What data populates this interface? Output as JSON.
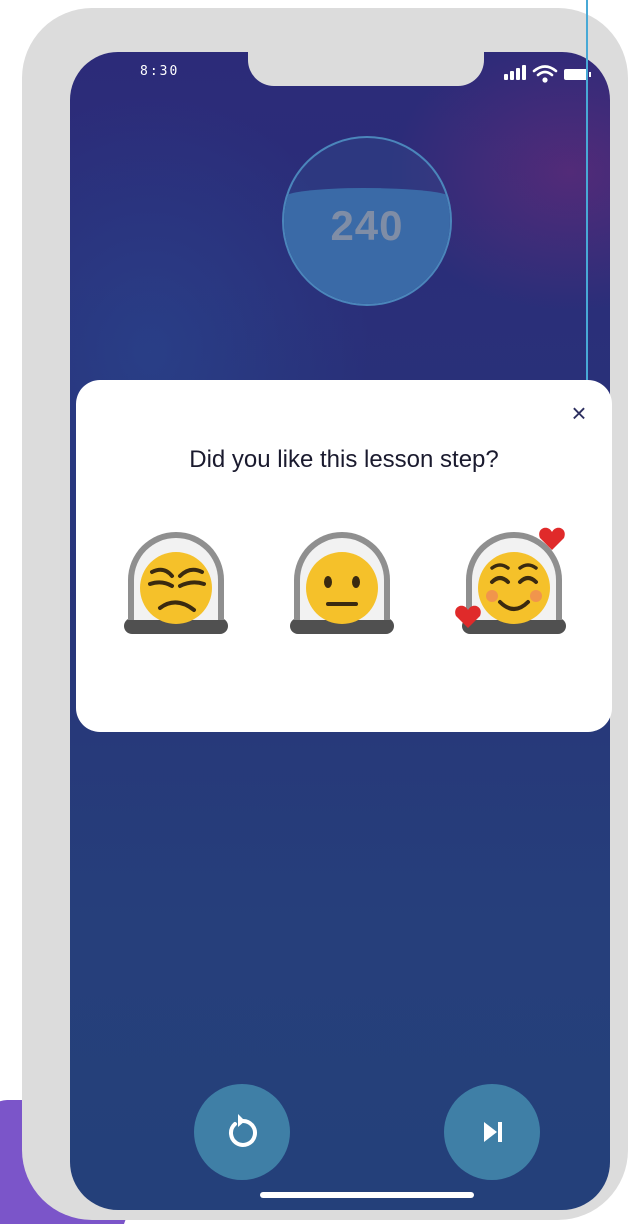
{
  "status_bar": {
    "time": "8:30",
    "icons": [
      "signal-icon",
      "wifi-icon",
      "battery-icon"
    ]
  },
  "score": {
    "value": "240",
    "fill_fraction": 0.7
  },
  "feedback": {
    "question": "Did you like this lesson step?",
    "close_icon": "×",
    "options": [
      {
        "name": "unamused-astronaut-emoji"
      },
      {
        "name": "neutral-astronaut-emoji"
      },
      {
        "name": "smiling-hearts-astronaut-emoji"
      }
    ]
  },
  "controls": {
    "replay_icon": "replay-icon",
    "skip_icon": "skip-next-icon"
  },
  "colors": {
    "background_top": "#2c2b79",
    "background_bottom": "#24407a",
    "card": "#ffffff",
    "control_button": "#3f7fa6",
    "accent_purple": "#7b55c9",
    "callout_line": "#48a9d6",
    "emoji_yellow": "#f5c12a"
  }
}
